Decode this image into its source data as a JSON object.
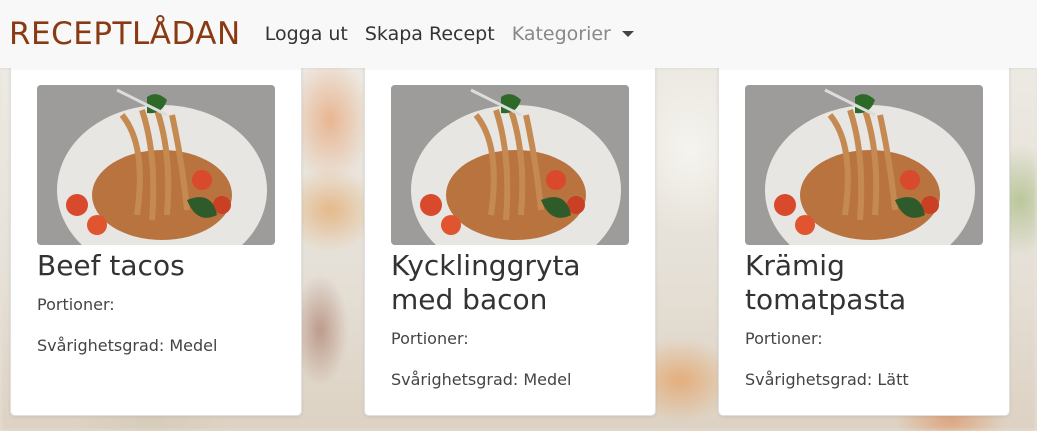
{
  "navbar": {
    "brand": "RECEPTLÅDAN",
    "links": [
      "Logga ut",
      "Skapa Recept",
      "Kategorier"
    ]
  },
  "recipes": [
    {
      "title": "Beef tacos",
      "portions_label": "Portioner:",
      "difficulty_label": "Svårighetsgrad: Medel"
    },
    {
      "title": "Kycklinggryta med bacon",
      "portions_label": "Portioner:",
      "difficulty_label": "Svårighetsgrad: Medel"
    },
    {
      "title": "Krämig tomatpasta",
      "portions_label": "Portioner:",
      "difficulty_label": "Svårighetsgrad: Lätt"
    }
  ],
  "colors": {
    "brand": "#8a3a12",
    "navbar_bg": "#f8f8f8"
  },
  "icons": {
    "dropdown": "caret-down-icon"
  }
}
